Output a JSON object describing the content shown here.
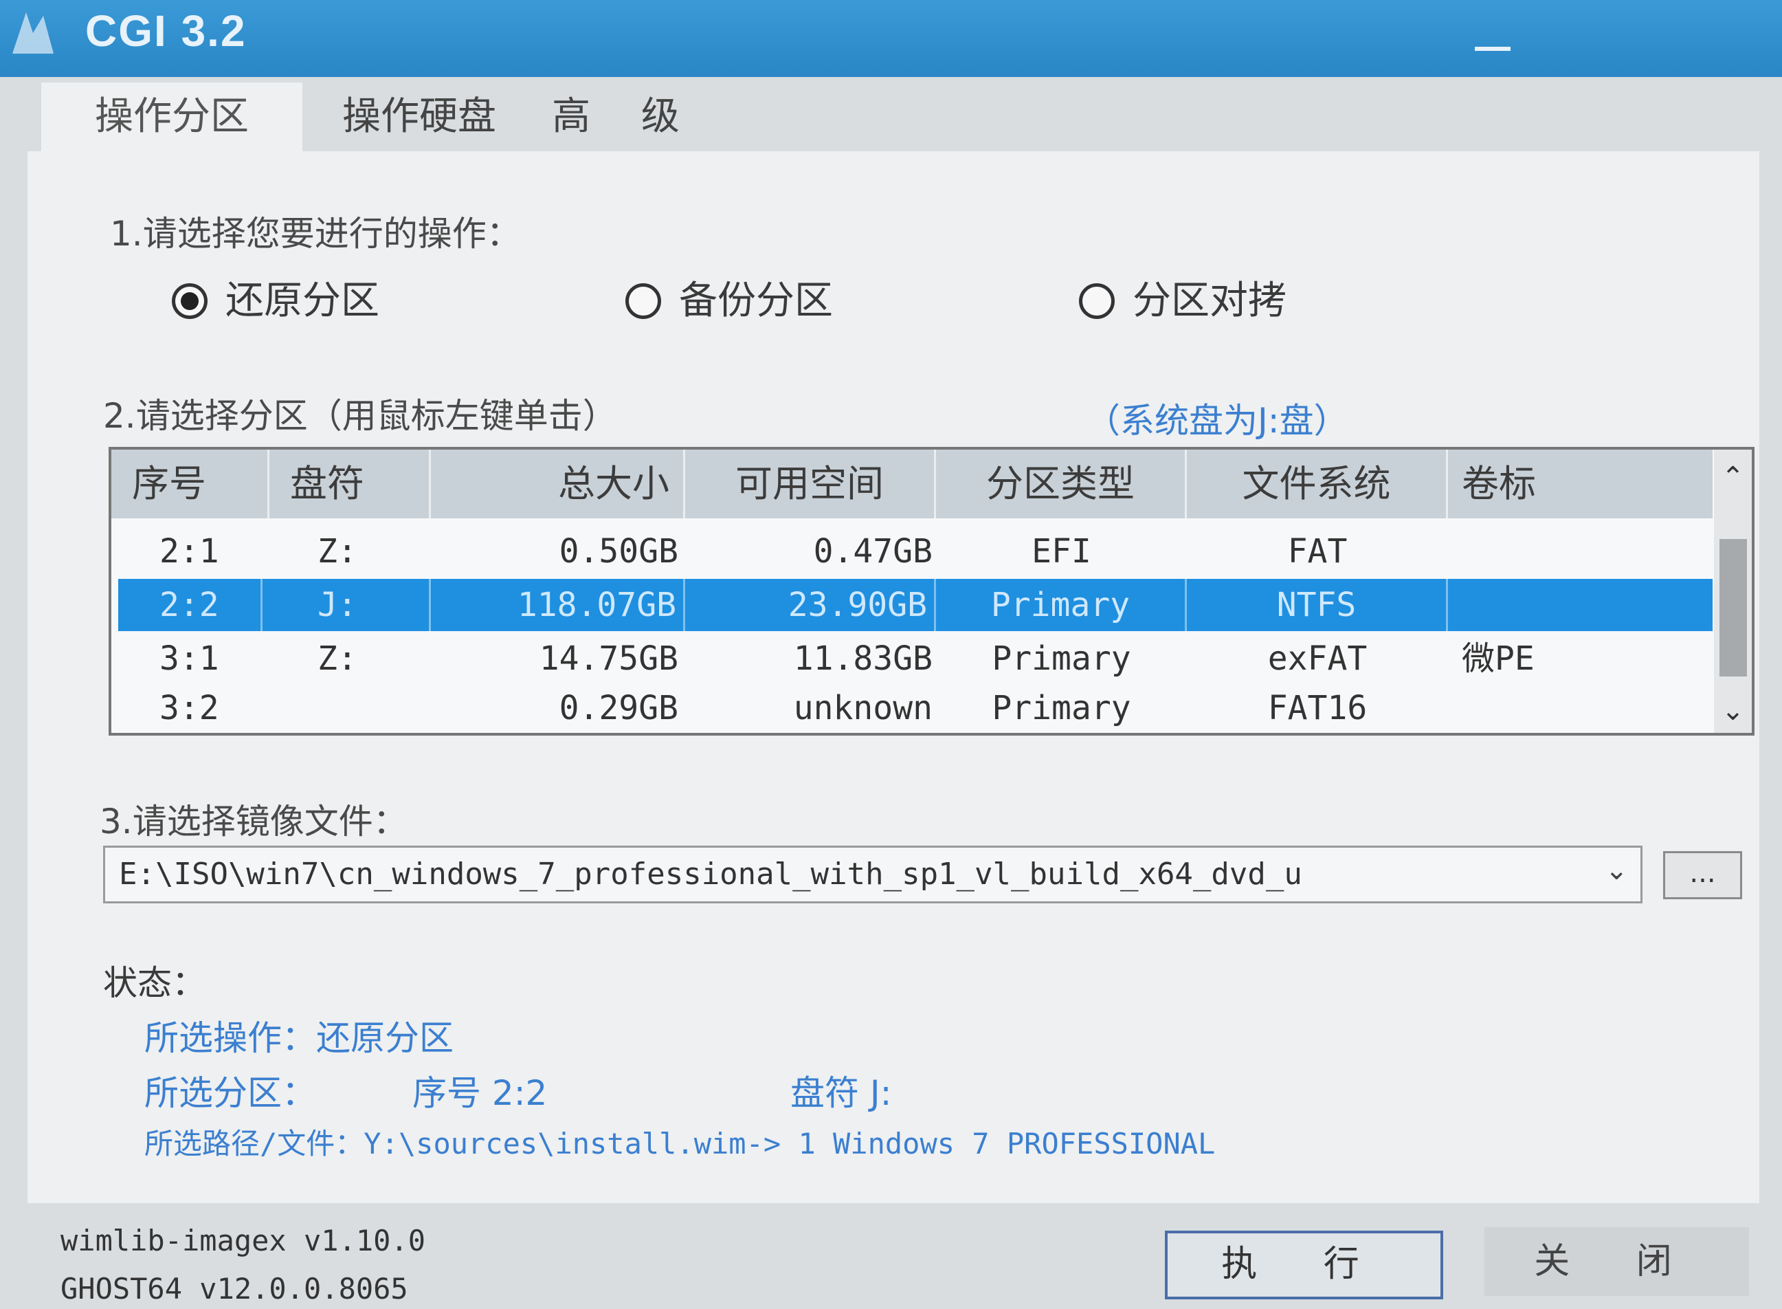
{
  "window": {
    "title": "CGI 3.2",
    "accent": "#2a86c6",
    "selection_color": "#1f8fe0",
    "link_color": "#3b7fd0"
  },
  "tabs": [
    {
      "label": "操作分区",
      "active": true
    },
    {
      "label": "操作硬盘",
      "active": false
    },
    {
      "label": "高 级",
      "active": false
    }
  ],
  "step1": {
    "label": "1.请选择您要进行的操作：",
    "options": [
      {
        "label": "还原分区",
        "selected": true
      },
      {
        "label": "备份分区",
        "selected": false
      },
      {
        "label": "分区对拷",
        "selected": false
      }
    ]
  },
  "step2": {
    "label": "2.请选择分区（用鼠标左键单击）",
    "system_disk": "（系统盘为J:盘）",
    "columns": [
      "序号",
      "盘符",
      "总大小",
      "可用空间",
      "分区类型",
      "文件系统",
      "卷标"
    ],
    "rows": [
      {
        "index": "2:1",
        "drive": "Z:",
        "size": "0.50GB",
        "free": "0.47GB",
        "type": "EFI",
        "fs": "FAT",
        "label": "",
        "selected": false
      },
      {
        "index": "2:2",
        "drive": "J:",
        "size": "118.07GB",
        "free": "23.90GB",
        "type": "Primary",
        "fs": "NTFS",
        "label": "",
        "selected": true
      },
      {
        "index": "3:1",
        "drive": "Z:",
        "size": "14.75GB",
        "free": "11.83GB",
        "type": "Primary",
        "fs": "exFAT",
        "label": "微PE",
        "selected": false
      },
      {
        "index": "3:2",
        "drive": "",
        "size": "0.29GB",
        "free": "unknown",
        "type": "Primary",
        "fs": "FAT16",
        "label": "",
        "selected": false
      }
    ]
  },
  "step3": {
    "label": "3.请选择镜像文件：",
    "image_path": "E:\\ISO\\win7\\cn_windows_7_professional_with_sp1_vl_build_x64_dvd_u",
    "browse_label": "..."
  },
  "status": {
    "title": "状态：",
    "operation_label": "所选操作：",
    "operation_value": "还原分区",
    "partition_label": "所选分区：",
    "partition_index": "序号 2:2",
    "partition_drive": "盘符 J:",
    "path_label": "所选路径/文件：",
    "path_value": "Y:\\sources\\install.wim-> 1  Windows 7 PROFESSIONAL"
  },
  "footer": {
    "version1": "wimlib-imagex v1.10.0",
    "version2": "GHOST64 v12.0.0.8065",
    "execute_label": "执 行",
    "close_label": "关 闭"
  }
}
